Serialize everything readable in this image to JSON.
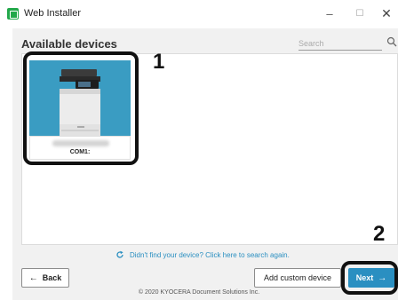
{
  "window": {
    "title": "Web Installer",
    "minimize_glyph": "–",
    "maximize_glyph": "☐",
    "close_glyph": "✕",
    "app_icon_color": "#22a84a"
  },
  "page": {
    "heading": "Available devices",
    "search_placeholder": "Search"
  },
  "devices": [
    {
      "port": "COM1:",
      "name_blurred": true,
      "card_color": "#3a9cc2"
    }
  ],
  "callouts": {
    "one": "1",
    "two": "2"
  },
  "links": {
    "not_found": "Didn't find your device? Click here to search again."
  },
  "buttons": {
    "back_label": "Back",
    "add_custom_label": "Add custom device",
    "next_label": "Next",
    "back_arrow": "←",
    "next_arrow": "→"
  },
  "footer": "© 2020 KYOCERA Document Solutions Inc.",
  "colors": {
    "accent": "#2a8fc1",
    "card": "#3a9cc2",
    "highlight": "#111111"
  }
}
